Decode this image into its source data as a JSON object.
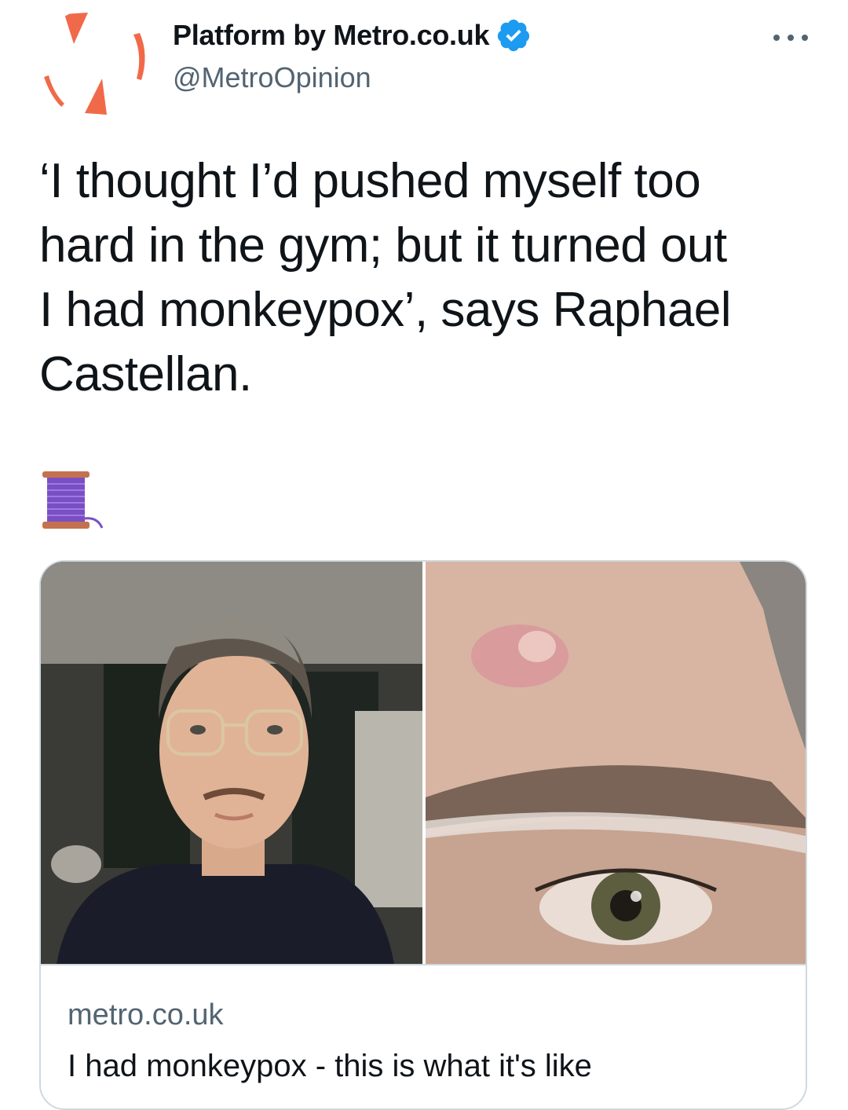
{
  "header": {
    "display_name": "Platform by Metro.co.uk",
    "handle": "@MetroOpinion",
    "verified_icon": "verified-check-icon",
    "more_icon": "more-horizontal-icon"
  },
  "tweet": {
    "text": "‘I thought I’d pushed myself too\nhard in the gym; but it turned out\nI had monkeypox’, says Raphael\nCastellan.",
    "emoji_icon": "spool-of-thread-icon"
  },
  "card": {
    "domain": "metro.co.uk",
    "title": "I had monkeypox - this is what it's like"
  },
  "colors": {
    "verified_blue": "#1d9bf0",
    "secondary_text": "#536471",
    "brand_orange": "#f06a4a",
    "thread_purple": "#7a4fc4"
  }
}
